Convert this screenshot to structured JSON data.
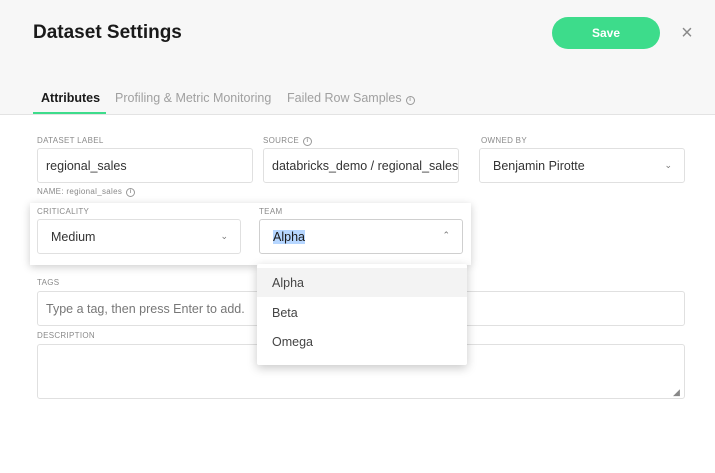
{
  "header": {
    "title": "Dataset Settings",
    "save_label": "Save",
    "close_label": "×"
  },
  "tabs": [
    {
      "label": "Attributes",
      "active": true
    },
    {
      "label": "Profiling & Metric Monitoring",
      "active": false
    },
    {
      "label": "Failed Row Samples",
      "active": false,
      "info_icon": "info-icon"
    }
  ],
  "form": {
    "dataset_label": {
      "label": "DATASET LABEL",
      "value": "regional_sales"
    },
    "source": {
      "label": "SOURCE",
      "info_icon": "info-icon",
      "value": "databricks_demo / regional_sales"
    },
    "owned_by": {
      "label": "OWNED BY",
      "value": "Benjamin Pirotte"
    },
    "name_hint": "NAME: regional_sales",
    "criticality": {
      "label": "CRITICALITY",
      "value": "Medium"
    },
    "team": {
      "label": "TEAM",
      "value": "Alpha",
      "options": [
        "Alpha",
        "Beta",
        "Omega"
      ]
    },
    "tags": {
      "label": "TAGS",
      "placeholder": "Type a tag, then press Enter to add."
    },
    "description": {
      "label": "DESCRIPTION",
      "value": ""
    }
  },
  "icons": {
    "chevron_down": "⌄",
    "chevron_up": "⌃",
    "info": "i",
    "resize": "◢"
  },
  "colors": {
    "accent": "#3ddc8b",
    "selection_highlight": "#b6d6ff"
  }
}
